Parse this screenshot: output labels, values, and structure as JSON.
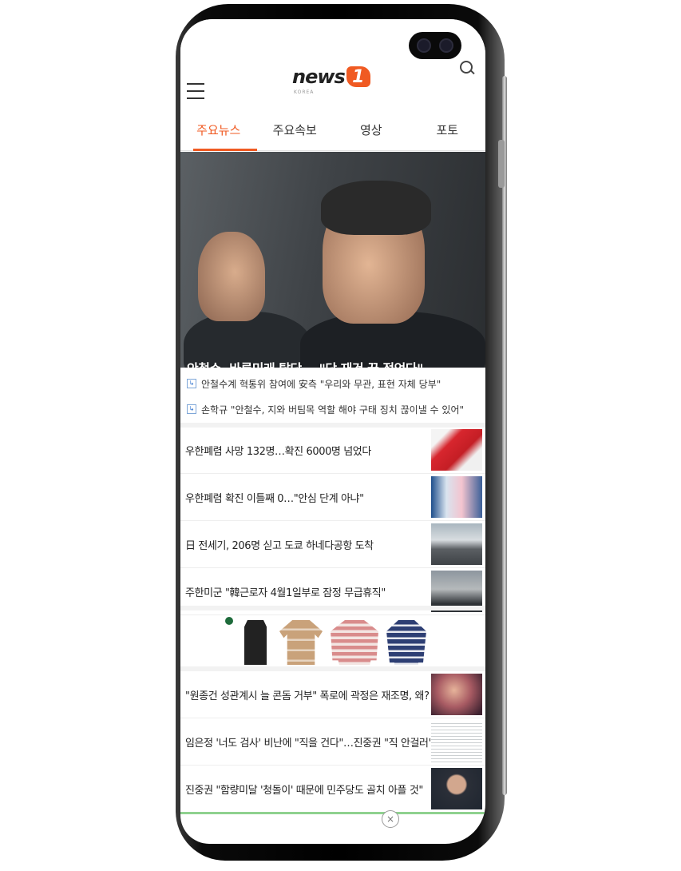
{
  "header": {
    "logo_text": "news",
    "logo_badge": "1",
    "logo_sub": "KOREA"
  },
  "tabs": [
    {
      "label": "주요뉴스",
      "active": true
    },
    {
      "label": "주요속보",
      "active": false
    },
    {
      "label": "영상",
      "active": false
    },
    {
      "label": "포토",
      "active": false
    }
  ],
  "hero": {
    "title": "안철수, 바른미래 탈당... \"당 재건 꿈 접었다\""
  },
  "related": [
    {
      "icon": "↳",
      "text": "안철수계 혁통위 참여에 安측 \"우리와 무관, 표현 자체 당부\""
    },
    {
      "icon": "↳",
      "text": "손학규 \"안철수, 지와 버팀목 역할 해야 구태 징치 끊이낼 수 있어\""
    }
  ],
  "news_list_1": [
    {
      "title": "우한폐렴 사망 132명…확진 6000명 넘었다"
    },
    {
      "title": "우한폐렴 확진 이틀째 0…\"안심 단계 아냐\""
    },
    {
      "title": "日 전세기, 206명 싣고 도쿄 하네다공항 도착"
    },
    {
      "title": "주한미군 \"韓근로자 4월1일부로 잠정 무급휴직\""
    }
  ],
  "news_list_2": [
    {
      "title": "\"원종건 성관계시 늘 콘돔 거부\" 폭로에 곽정은 재조명, 왜?"
    },
    {
      "title": "임은정 '너도 검사' 비난에 \"직을 건다\"…진중권 \"직 안걸러\""
    },
    {
      "title": "진중권 \"함량미달 '청돌이' 때문에 민주당도 골치 아플 것\""
    }
  ],
  "colors": {
    "brand": "#f05a22",
    "text": "#222222",
    "divider": "#eeeeee"
  },
  "icons": [
    "hamburger-menu-icon",
    "search-icon",
    "related-link-icon",
    "close-icon"
  ],
  "ad": {
    "close_symbol": "×"
  }
}
